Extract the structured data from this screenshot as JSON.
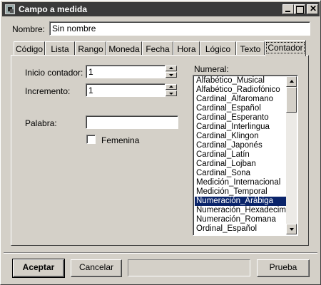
{
  "window": {
    "title": "Campo a medida"
  },
  "name": {
    "label": "Nombre:",
    "value": "Sin nombre"
  },
  "tabs": [
    {
      "label": "Código"
    },
    {
      "label": "Lista"
    },
    {
      "label": "Rango"
    },
    {
      "label": "Moneda"
    },
    {
      "label": "Fecha"
    },
    {
      "label": "Hora"
    },
    {
      "label": "Lógico"
    },
    {
      "label": "Texto"
    },
    {
      "label": "Contador",
      "active": true
    }
  ],
  "counter": {
    "start_label": "Inicio contador:",
    "start_value": "1",
    "increment_label": "Incremento:",
    "increment_value": "1",
    "word_label": "Palabra:",
    "word_value": "",
    "feminine_label": "Femenina",
    "feminine_checked": false
  },
  "numeral": {
    "label": "Numeral:",
    "items": [
      "Alfabético_Musical",
      "Alfabético_Radiofónico",
      "Cardinal_Alfaromano",
      "Cardinal_Español",
      "Cardinal_Esperanto",
      "Cardinal_Interlingua",
      "Cardinal_Klingon",
      "Cardinal_Japonés",
      "Cardinal_Latín",
      "Cardinal_Lojban",
      "Cardinal_Sona",
      "Medición_Internacional",
      "Medición_Temporal",
      "Numeración_Arábiga",
      "Numeración_Hexadecimal",
      "Numeración_Romana",
      "Ordinal_Español"
    ],
    "selected": "Numeración_Arábiga"
  },
  "footer": {
    "accept_label": "Aceptar",
    "cancel_label": "Cancelar",
    "status_text": "",
    "test_label": "Prueba"
  }
}
